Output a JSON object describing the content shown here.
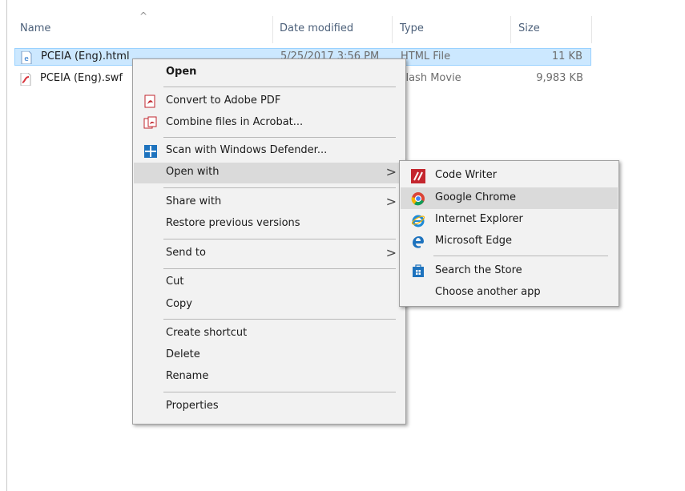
{
  "columns": {
    "name": "Name",
    "date_modified": "Date modified",
    "type": "Type",
    "size": "Size",
    "sort_indicator": "^"
  },
  "files": [
    {
      "name": "PCEIA (Eng).html",
      "date": "5/25/2017 3:56 PM",
      "type": "HTML File",
      "size": "11 KB",
      "icon": "html-file-icon",
      "selected": true
    },
    {
      "name": "PCEIA (Eng).swf",
      "date": "",
      "type": "Flash Movie",
      "size": "9,983 KB",
      "icon": "flash-file-icon",
      "selected": false
    }
  ],
  "context_menu": {
    "open": "Open",
    "convert_pdf": "Convert to Adobe PDF",
    "combine_acrobat": "Combine files in Acrobat...",
    "scan_defender": "Scan with Windows Defender...",
    "open_with": "Open with",
    "share_with": "Share with",
    "restore_versions": "Restore previous versions",
    "send_to": "Send to",
    "cut": "Cut",
    "copy": "Copy",
    "create_shortcut": "Create shortcut",
    "delete": "Delete",
    "rename": "Rename",
    "properties": "Properties",
    "submenu_arrow": ">"
  },
  "open_with_menu": {
    "code_writer": "Code Writer",
    "google_chrome": "Google Chrome",
    "internet_explorer": "Internet Explorer",
    "microsoft_edge": "Microsoft Edge",
    "search_store": "Search the Store",
    "choose_app": "Choose another app"
  },
  "colors": {
    "selection_bg": "#cce8ff",
    "menu_bg": "#f2f2f2",
    "menu_hover": "#dadada",
    "header_text": "#4c607a"
  }
}
